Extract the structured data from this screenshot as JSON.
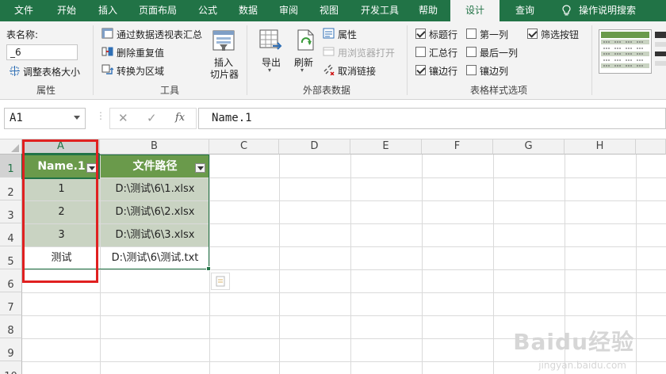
{
  "tabs": {
    "file": "文件",
    "home": "开始",
    "insert": "插入",
    "page_layout": "页面布局",
    "formulas": "公式",
    "data": "数据",
    "review": "审阅",
    "view": "视图",
    "developer": "开发工具",
    "help": "帮助",
    "design": "设计",
    "query": "查询",
    "tell_me": "操作说明搜索"
  },
  "ribbon": {
    "properties": {
      "table_name_label": "表名称:",
      "table_name_value": "_6",
      "resize": "调整表格大小",
      "group_label": "属性"
    },
    "tools": {
      "summarize_pivot": "通过数据透视表汇总",
      "remove_duplicates": "删除重复值",
      "convert_to_range": "转换为区域",
      "insert_slicer_line1": "插入",
      "insert_slicer_line2": "切片器",
      "group_label": "工具"
    },
    "external": {
      "export": "导出",
      "refresh": "刷新",
      "properties": "属性",
      "open_browser": "用浏览器打开",
      "unlink": "取消链接",
      "group_label": "外部表数据"
    },
    "style_options": {
      "header_row": "标题行",
      "total_row": "汇总行",
      "banded_rows": "镶边行",
      "first_column": "第一列",
      "last_column": "最后一列",
      "banded_columns": "镶边列",
      "filter_button": "筛选按钮",
      "header_row_checked": true,
      "total_row_checked": false,
      "banded_rows_checked": true,
      "first_column_checked": false,
      "last_column_checked": false,
      "banded_columns_checked": false,
      "filter_button_checked": true,
      "group_label": "表格样式选项"
    }
  },
  "formula_bar": {
    "name_box": "A1",
    "cancel": "✕",
    "enter": "✓",
    "fx": "fx",
    "content": "Name.1"
  },
  "sheet": {
    "columns": [
      "A",
      "B",
      "C",
      "D",
      "E",
      "F",
      "G",
      "H"
    ],
    "rows": [
      "1",
      "2",
      "3",
      "4",
      "5",
      "6",
      "7",
      "8",
      "9",
      "10"
    ],
    "table": {
      "headers": [
        "Name.1",
        "文件路径"
      ],
      "rows": [
        [
          "1",
          "D:\\测试\\6\\1.xlsx"
        ],
        [
          "2",
          "D:\\测试\\6\\2.xlsx"
        ],
        [
          "3",
          "D:\\测试\\6\\3.xlsx"
        ],
        [
          "测试",
          "D:\\测试\\6\\测试.txt"
        ]
      ]
    }
  },
  "watermark": {
    "brand": "Baidu经验",
    "url": "jingyan.baidu.com"
  },
  "colors": {
    "excel_green": "#217346",
    "table_header": "#6a9a4b",
    "table_band": "#c9d3c2",
    "highlight_red": "#e02020"
  }
}
